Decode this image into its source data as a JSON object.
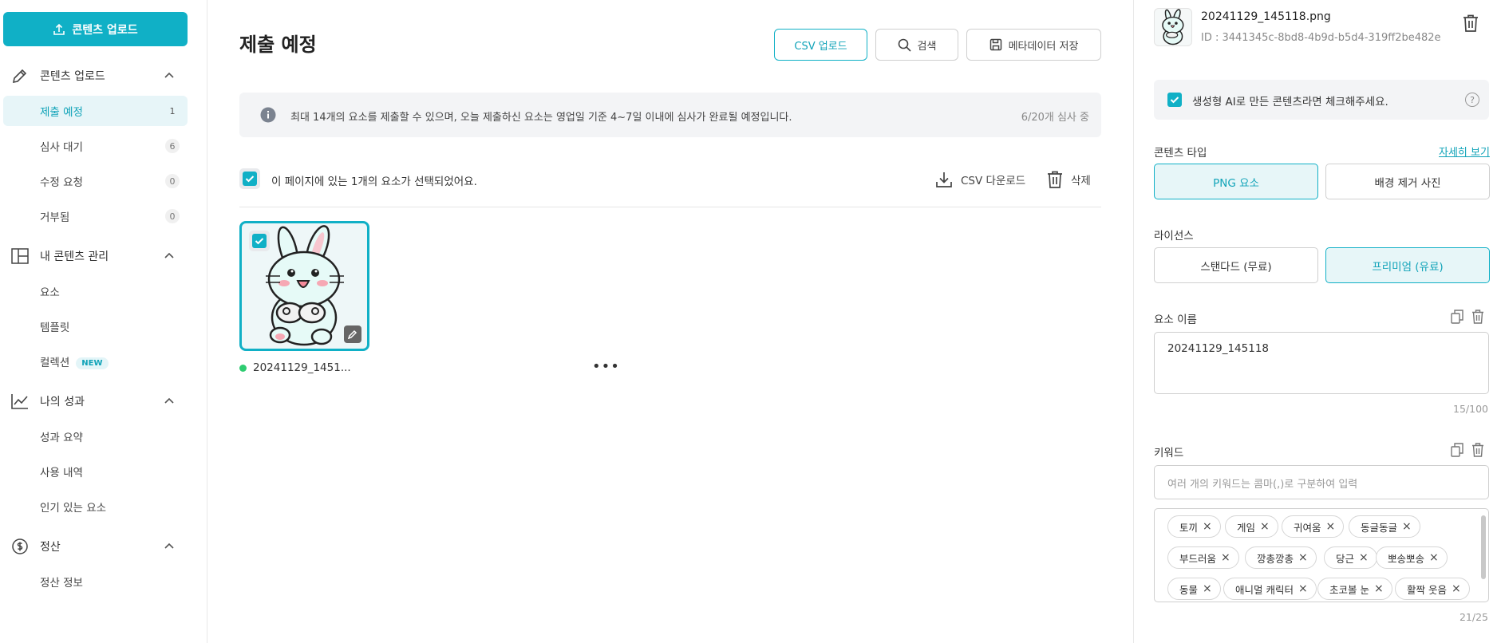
{
  "colors": {
    "accent": "#10b0c6",
    "status_ok": "#2ecc71"
  },
  "sidebar": {
    "upload_button": "콘텐츠 업로드",
    "sections": [
      {
        "label": "콘텐츠 업로드",
        "icon": "pencil-icon"
      },
      {
        "label": "내 콘텐츠 관리",
        "icon": "grid-icon"
      },
      {
        "label": "나의 성과",
        "icon": "chart-line-icon"
      },
      {
        "label": "정산",
        "icon": "dollar-circle-icon"
      }
    ],
    "upload_items": [
      {
        "label": "제출 예정",
        "count": "1"
      },
      {
        "label": "심사 대기",
        "count": "6"
      },
      {
        "label": "수정 요청",
        "count": "0"
      },
      {
        "label": "거부됨",
        "count": "0"
      }
    ],
    "content_items": [
      "요소",
      "템플릿",
      "컬렉션"
    ],
    "new_badge": "NEW",
    "performance_items": [
      "성과 요약",
      "사용 내역",
      "인기 있는 요소"
    ],
    "settlement_items": [
      "정산 정보"
    ]
  },
  "main": {
    "title": "제출 예정",
    "buttons": {
      "csv_upload": "CSV 업로드",
      "search": "검색",
      "save_metadata": "메타데이터 저장"
    },
    "info": {
      "message": "최대 14개의 요소를 제출할 수 있으며, 오늘 제출하신 요소는 영업일 기준 4~7일 이내에 심사가 완료될 예정입니다.",
      "status": "6/20개 심사 중"
    },
    "selection_text": "이 페이지에 있는 1개의 요소가 선택되었어요.",
    "csv_download": "CSV 다운로드",
    "delete": "삭제",
    "items": [
      {
        "name": "20241129_1451...",
        "more": "•••"
      }
    ]
  },
  "panel": {
    "file_name": "20241129_145118.png",
    "file_id": "ID : 3441345c-8bd8-4b9d-b5d4-319ff2be482e",
    "ai_check_label": "생성형 AI로 만든 콘텐츠라면 체크해주세요.",
    "help": "?",
    "content_type_label": "콘텐츠 타입",
    "detail_link": "자세히 보기",
    "content_types": [
      "PNG 요소",
      "배경 제거 사진"
    ],
    "content_type_selected": "PNG 요소",
    "license_label": "라이선스",
    "licenses": [
      "스탠다드 (무료)",
      "프리미엄 (유료)"
    ],
    "license_selected": "프리미엄 (유료)",
    "element_name_label": "요소 이름",
    "element_name_value": "20241129_145118",
    "element_name_counter": "15/100",
    "keyword_label": "키워드",
    "keyword_placeholder": "여러 개의 키워드는 콤마(,)로 구분하여 입력",
    "keywords": [
      "토끼",
      "게임",
      "귀여움",
      "동글동글",
      "부드러움",
      "깡총깡총",
      "당근",
      "뽀송뽀송",
      "동물",
      "애니멀 캐릭터",
      "초코볼 눈",
      "활짝 웃음"
    ],
    "keyword_counter": "21/25"
  }
}
